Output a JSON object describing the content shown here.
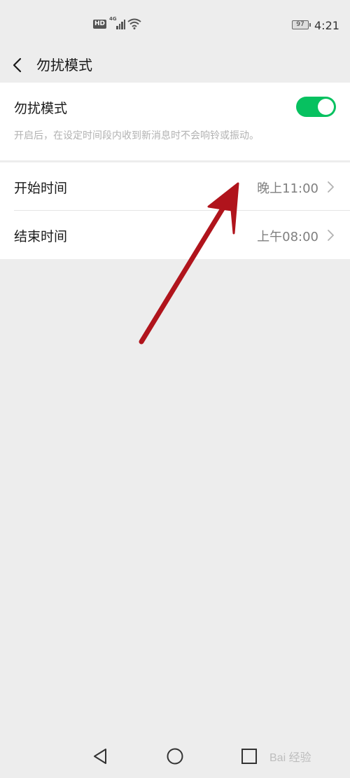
{
  "status_bar": {
    "hd": "HD",
    "network": "4G",
    "battery": "97",
    "time": "4:21"
  },
  "nav": {
    "title": "勿扰模式",
    "back_icon": "chevron-left-icon"
  },
  "dnd": {
    "label": "勿扰模式",
    "description": "开启后，在设定时间段内收到新消息时不会响铃或振动。",
    "enabled": true,
    "toggle_color": "#07c160"
  },
  "rows": [
    {
      "label": "开始时间",
      "value": "晚上11:00"
    },
    {
      "label": "结束时间",
      "value": "上午08:00"
    }
  ],
  "annotation": {
    "color": "#b0141c"
  },
  "system_nav": [
    "back-triangle-icon",
    "home-circle-icon",
    "recents-square-icon"
  ],
  "watermark": "Bai 经验"
}
